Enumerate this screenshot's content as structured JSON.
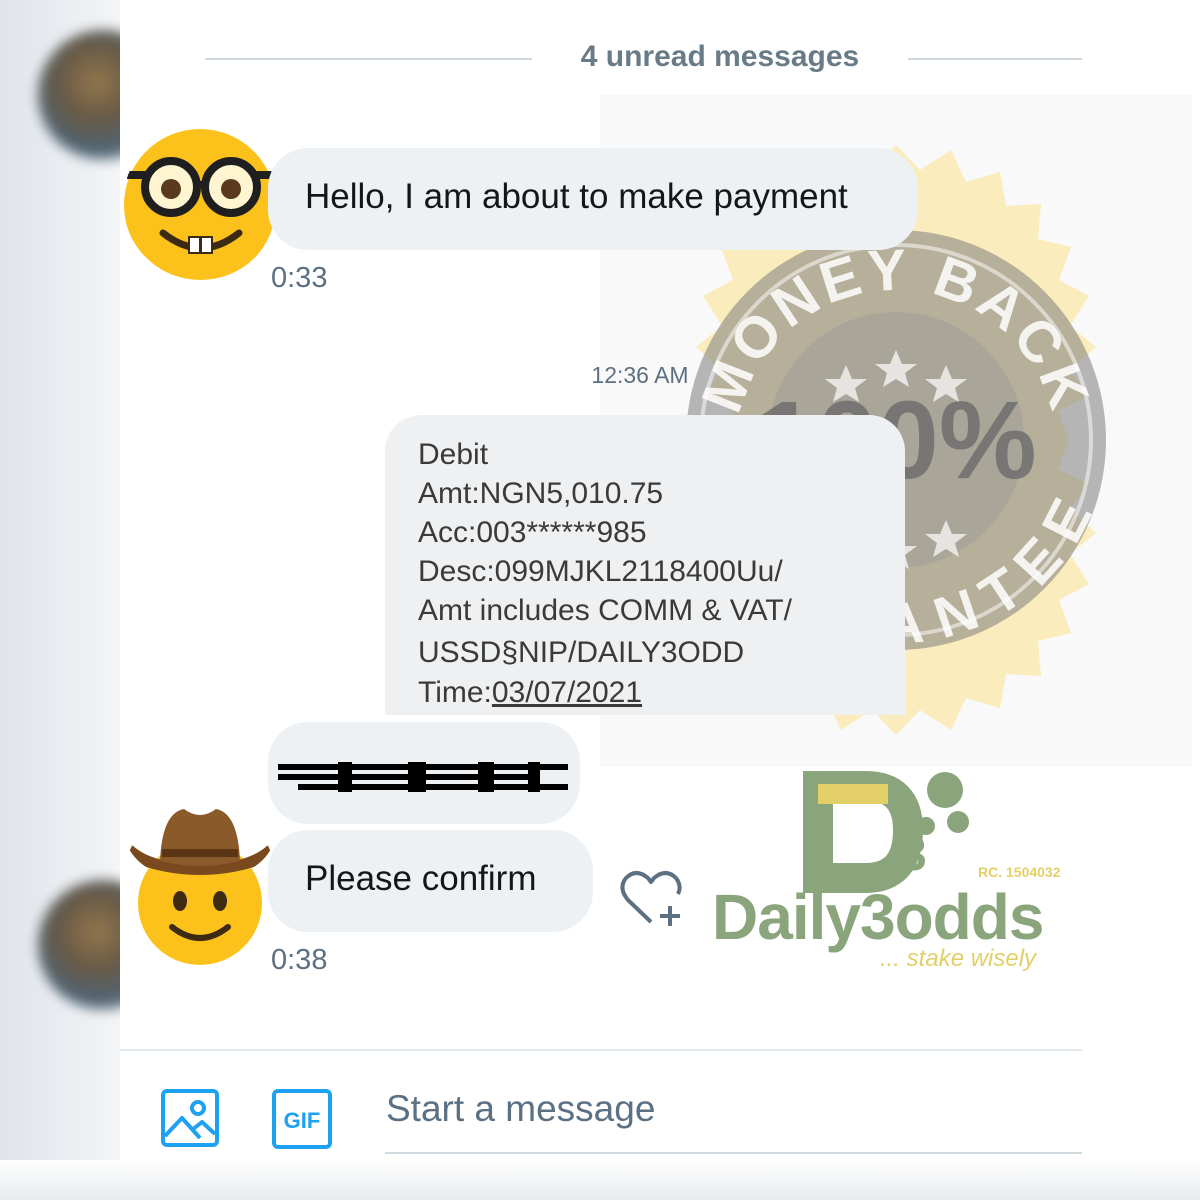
{
  "conversation": {
    "unread_label": "4 unread messages",
    "middle_timestamp": "12:36 AM"
  },
  "messages": [
    {
      "text": "Hello, I am about to make payment",
      "time": "0:33",
      "avatar": "nerd-face-emoji-icon"
    },
    {
      "text": "Please confirm",
      "time": "0:38",
      "avatar": "cowboy-face-emoji-icon"
    }
  ],
  "sms_screenshot": {
    "lines": [
      "Debit",
      "Amt:NGN5,010.75",
      "Acc:003******985",
      "Desc:099MJKL2118400Uu/",
      "Amt includes COMM & VAT/",
      "USSD§NIP/DAILY3ODD"
    ],
    "time_label": "Time:",
    "time_value": "03/07/2021"
  },
  "composer": {
    "placeholder": "Start a message",
    "image_button": "image-icon",
    "gif_button": "GIF"
  },
  "overlay": {
    "seal_line1": "MONEY BACK",
    "seal_percent": "100%",
    "seal_line2": "GUARANTEE",
    "brand_name": "Daily3odds",
    "brand_tagline": "... stake wisely",
    "brand_rc": "RC. 1504032",
    "logo_letter": "D",
    "logo_superscript": "3"
  },
  "colors": {
    "bubble": "#eef1f4",
    "secondary_text": "#5b7083",
    "accent": "#1da1f2",
    "brand_green": "#8aa57b",
    "brand_yellow": "#e3cf68"
  }
}
